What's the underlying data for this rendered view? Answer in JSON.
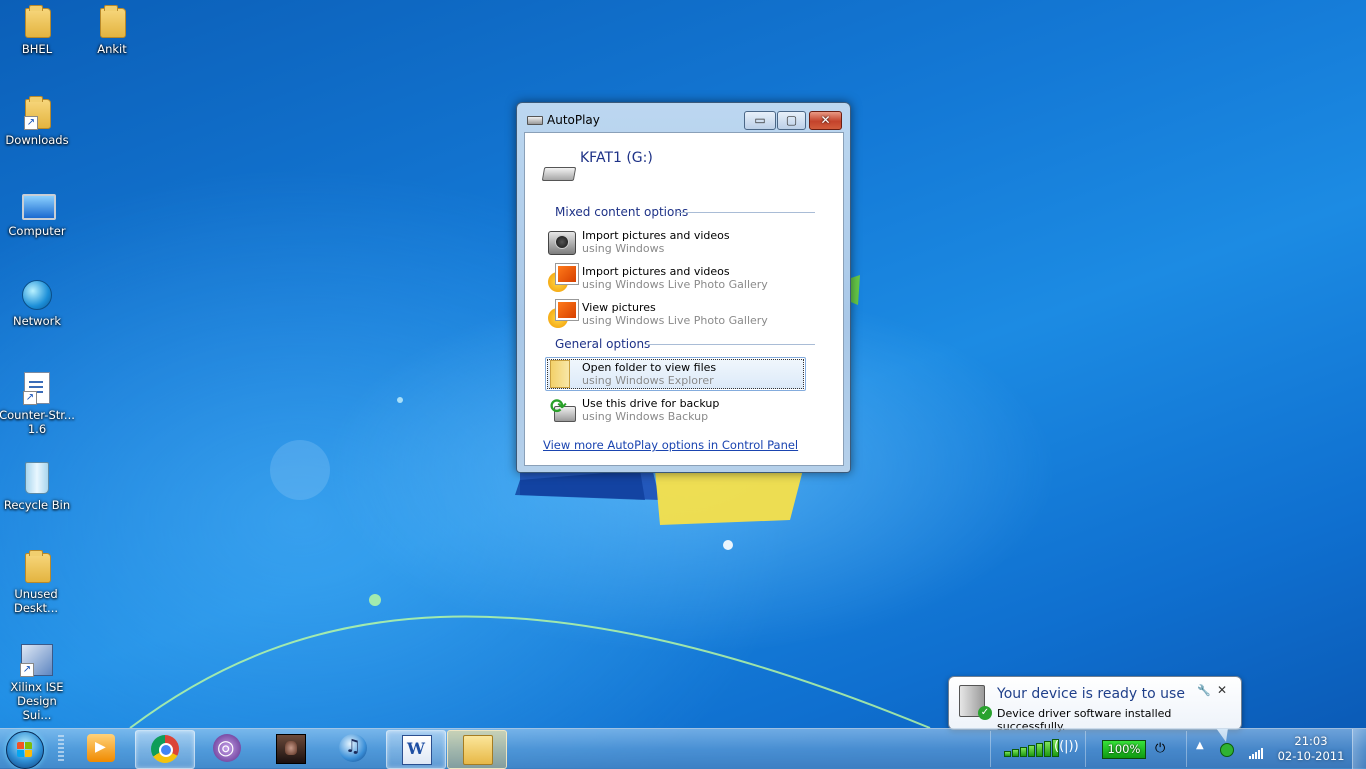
{
  "desktop": {
    "icons": [
      {
        "label": "BHEL",
        "icon": "folder-icon"
      },
      {
        "label": "Ankit",
        "icon": "folder-icon"
      },
      {
        "label": "Downloads",
        "icon": "folder-shortcut-icon"
      },
      {
        "label": "Computer",
        "icon": "computer-icon"
      },
      {
        "label": "Network",
        "icon": "network-icon"
      },
      {
        "label": "Counter-Str... 1.6",
        "icon": "document-shortcut-icon"
      },
      {
        "label": "Recycle Bin",
        "icon": "recycle-bin-icon"
      },
      {
        "label": "Unused Deskt...",
        "icon": "folder-icon"
      },
      {
        "label": "Xilinx ISE Design Sui...",
        "icon": "app-shortcut-icon"
      }
    ]
  },
  "autoplay": {
    "title": "AutoPlay",
    "drive_name": "KFAT1 (G:)",
    "section_mixed": "Mixed content options",
    "section_general": "General options",
    "options": [
      {
        "line1": "Import pictures and videos",
        "line2": "using Windows"
      },
      {
        "line1": "Import pictures and videos",
        "line2": "using Windows Live Photo Gallery"
      },
      {
        "line1": "View pictures",
        "line2": "using Windows Live Photo Gallery"
      },
      {
        "line1": "Open folder to view files",
        "line2": "using Windows Explorer"
      },
      {
        "line1": "Use this drive for backup",
        "line2": "using Windows Backup"
      }
    ],
    "control_panel_link": "View more AutoPlay options in Control Panel",
    "buttons": {
      "minimize": "▭",
      "maximize": "▢",
      "close": "✕"
    }
  },
  "notification": {
    "title": "Your device is ready to use",
    "text": "Device driver software installed successfully.",
    "pin_glyph": "🔧",
    "close_glyph": "✕"
  },
  "taskbar": {
    "apps": [
      "windows-media-player",
      "google-chrome",
      "bittorrent",
      "game",
      "itunes",
      "microsoft-word",
      "windows-explorer"
    ],
    "battery": "100%",
    "time": "21:03",
    "date": "02-10-2011"
  }
}
